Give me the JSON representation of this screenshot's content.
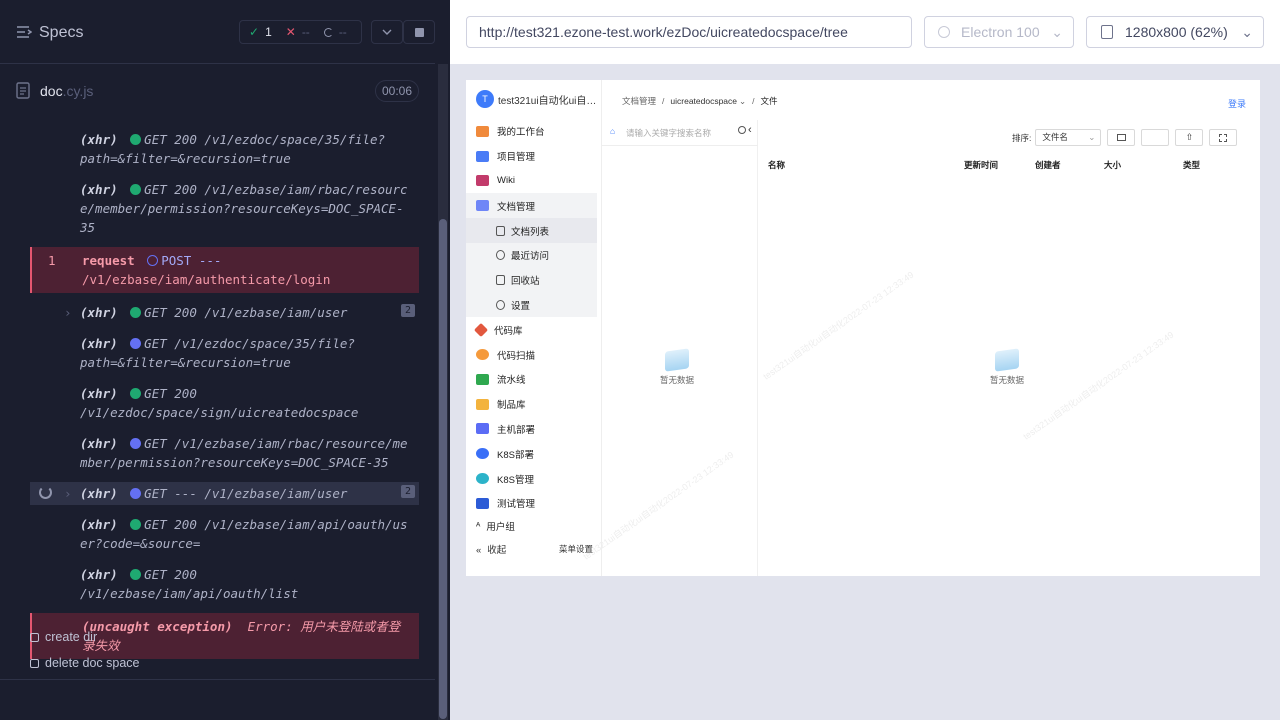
{
  "cypress": {
    "specs_title": "Specs",
    "stats": {
      "passed": "1",
      "failed": "--",
      "pending": "--"
    },
    "file": {
      "name": "doc",
      "ext": ".cy.js",
      "timer": "00:06"
    },
    "log": [
      {
        "kind": "(xhr)",
        "status": "green",
        "text": "GET 200 /v1/ezdoc/space/35/file?path=&filter=&recursion=true"
      },
      {
        "kind": "(xhr)",
        "status": "green",
        "text": "GET 200 /v1/ezbase/iam/rbac/resource/member/permission?resourceKeys=DOC_SPACE-35"
      },
      {
        "kind": "request",
        "index": "1",
        "status": "pending",
        "method": "POST ---",
        "text": "/v1/ezbase/iam/authenticate/login"
      },
      {
        "kind": "(xhr)",
        "status": "green",
        "text": "GET 200 /v1/ezbase/iam/user",
        "badge": "2"
      },
      {
        "kind": "(xhr)",
        "status": "blue",
        "text": "GET /v1/ezdoc/space/35/file?path=&filter=&recursion=true"
      },
      {
        "kind": "(xhr)",
        "status": "green",
        "text": "GET 200 /v1/ezdoc/space/sign/uicreatedocspace"
      },
      {
        "kind": "(xhr)",
        "status": "blue",
        "text": "GET /v1/ezbase/iam/rbac/resource/member/permission?resourceKeys=DOC_SPACE-35"
      },
      {
        "kind": "(xhr)",
        "status": "blue",
        "text": "GET --- /v1/ezbase/iam/user",
        "badge": "2"
      },
      {
        "kind": "(xhr)",
        "status": "green",
        "text": "GET 200 /v1/ezbase/iam/api/oauth/user?code=&source="
      },
      {
        "kind": "(xhr)",
        "status": "green",
        "text": "GET 200 /v1/ezbase/iam/api/oauth/list"
      },
      {
        "kind": "(uncaught exception)",
        "text": "Error: 用户未登陆或者登录失效"
      }
    ],
    "tests": [
      "create dir",
      "delete doc space"
    ],
    "url": "http://test321.ezone-test.work/ezDoc/uicreatedocspace/tree",
    "browser": "Electron 100",
    "viewport": "1280x800 (62%)"
  },
  "app": {
    "org_initial": "T",
    "org_name": "test321ui自动化ui自…",
    "breadcrumb": [
      "文档管理",
      "uicreatedocspace",
      "文件"
    ],
    "login": "登录",
    "nav": [
      {
        "label": "我的工作台",
        "color": "#f08a3c"
      },
      {
        "label": "项目管理",
        "color": "#4a7cf6"
      },
      {
        "label": "Wiki",
        "color": "#c23b6b"
      },
      {
        "label": "文档管理",
        "color": "#6f86f7"
      },
      {
        "label": "文档列表",
        "sub": true
      },
      {
        "label": "最近访问",
        "sub": true
      },
      {
        "label": "回收站",
        "sub": true
      },
      {
        "label": "设置",
        "sub": true
      },
      {
        "label": "代码库",
        "color": "#e2583e"
      },
      {
        "label": "代码扫描",
        "color": "#f59a3c"
      },
      {
        "label": "流水线",
        "color": "#2fa84f"
      },
      {
        "label": "制品库",
        "color": "#f3b33d"
      },
      {
        "label": "主机部署",
        "color": "#5b6cf5"
      },
      {
        "label": "K8S部署",
        "color": "#3a6ff7"
      },
      {
        "label": "K8S管理",
        "color": "#2cb3c9"
      },
      {
        "label": "测试管理",
        "color": "#2c5bd6"
      }
    ],
    "user_group": "用户组",
    "collapse": "收起",
    "menu_settings": "菜单设置",
    "search_placeholder": "请输入关键字搜索名称",
    "empty_text": "暂无数据",
    "sort_label": "排序:",
    "sort_value": "文件名",
    "columns": [
      "名称",
      "更新时间",
      "创建者",
      "大小",
      "类型"
    ],
    "watermark": "test321ui自动化ui自动化2022-07-23 12:33:49"
  }
}
